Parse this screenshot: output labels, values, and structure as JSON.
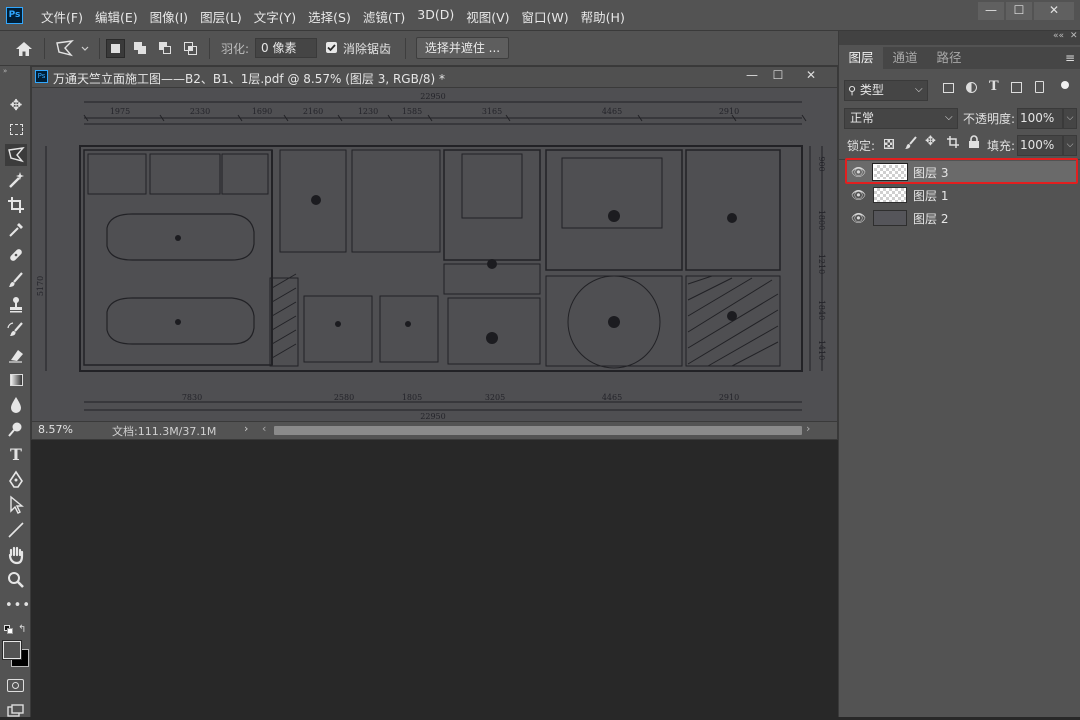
{
  "app": {
    "logo": "Ps"
  },
  "menu": [
    "文件(F)",
    "编辑(E)",
    "图像(I)",
    "图层(L)",
    "文字(Y)",
    "选择(S)",
    "滤镜(T)",
    "3D(D)",
    "视图(V)",
    "窗口(W)",
    "帮助(H)"
  ],
  "window_controls": {
    "minimize": "—",
    "maximize": "☐",
    "close": "✕"
  },
  "options": {
    "feather_label": "羽化:",
    "feather_value": "0 像素",
    "antialias_label": "消除锯齿",
    "select_mask_button": "选择并遮住 ..."
  },
  "document": {
    "title": "万通天竺立面施工图——B2、B1、1层.pdf @ 8.57% (图层 3, RGB/8) *",
    "zoom": "8.57%",
    "doc_info": "文档:111.3M/37.1M",
    "dims_top": [
      "1975",
      "2330",
      "1690",
      "2160",
      "1230",
      "1585",
      "3165",
      "4465",
      "2910"
    ],
    "dims_top_total": "22950",
    "dims_bottom": [
      "7830",
      "2580",
      "1805",
      "3205",
      "4465",
      "2910"
    ],
    "dims_bottom_total": "22950",
    "dims_left": [
      "5170"
    ],
    "dims_right": [
      "900",
      "1800",
      "1210",
      "1840",
      "1410"
    ]
  },
  "panel": {
    "tabs": [
      "图层",
      "通道",
      "路径"
    ],
    "filter_kind": "类型",
    "blend_mode": "正常",
    "opacity_label": "不透明度:",
    "opacity_value": "100%",
    "lock_label": "锁定:",
    "fill_label": "填充:",
    "fill_value": "100%",
    "layers": [
      {
        "name": "图层 3",
        "selected": true
      },
      {
        "name": "图层 1",
        "selected": false
      },
      {
        "name": "图层 2",
        "selected": false
      }
    ]
  },
  "colors": {
    "highlight": "#e21f1f",
    "ps_blue": "#31a8ff",
    "ui_gray": "#535353",
    "canvas_bg": "#282828"
  }
}
